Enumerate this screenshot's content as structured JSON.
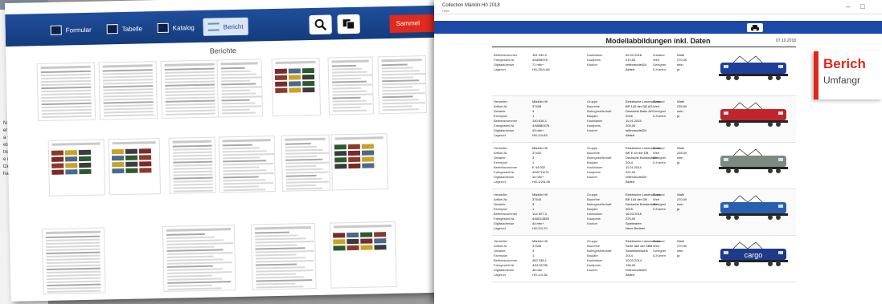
{
  "background_page": {
    "text_lines": [
      "NIC",
      "erb",
      "a G",
      "etric",
      "tren",
      "e n",
      "tzer",
      "halt"
    ]
  },
  "left_app": {
    "tabs": [
      {
        "label": "Formular",
        "icon": "form-icon"
      },
      {
        "label": "Tabelle",
        "icon": "table-icon"
      },
      {
        "label": "Katalog",
        "icon": "catalog-icon"
      },
      {
        "label": "Bericht",
        "icon": "report-icon",
        "active": true
      }
    ],
    "sammel_label": "Sammel",
    "panel_title": "Berichte"
  },
  "right_doc": {
    "window_title": "Collection Märklin H0 2018",
    "window_subtitle": "HBfx",
    "report_title": "Modellabbildungen inkl. Daten",
    "date": "07.10.2018",
    "rows": [
      {
        "col1": [
          [
            "Betriebsnummer",
            "151 032-0"
          ],
          [
            "Fahrgestell-Nr.",
            "4/4835978"
          ],
          [
            "Digitaladresse",
            "71 mfx+"
          ],
          [
            "Lagerort",
            "HG-3D/4-66"
          ]
        ],
        "col2": [
          [
            "Kaufdatum",
            "02.02.2018"
          ],
          [
            "Kaufpreis",
            "210,00"
          ],
          [
            "Kaufort",
            "reflexmodell24"
          ],
          [
            "",
            "Aktiert"
          ]
        ],
        "col3": [
          [
            "Zustand",
            "Wahl"
          ],
          [
            "Wert",
            "270,00"
          ],
          [
            "Geeignet",
            "nein"
          ],
          [
            "D-Karten",
            "ja"
          ]
        ],
        "loco_color": "#1e3f9a"
      },
      {
        "col1": [
          [
            "Hersteller",
            "Märklin H0"
          ],
          [
            "Artikel-Nr.",
            "37438"
          ],
          [
            "Variante",
            "3"
          ],
          [
            "Exemplar",
            "1"
          ],
          [
            "Betriebsnummer",
            "140 816-1"
          ],
          [
            "Fahrgestell-Nr.",
            "4/48680476"
          ],
          [
            "Digitaladresse",
            "43 mfx+"
          ],
          [
            "Lagerort",
            "HG-1/4-83"
          ]
        ],
        "col2": [
          [
            "Gruppe",
            "Elektrische Lokomotiven"
          ],
          [
            "Baureihe",
            "BR 140 der DB AG"
          ],
          [
            "Bahngesellschaft",
            "Deutsche Bahn AG"
          ],
          [
            "Baujahr",
            "2016"
          ],
          [
            "Kaufdatum",
            "11.01.2015"
          ],
          [
            "Kaufpreis",
            "205,00"
          ],
          [
            "Kaufort",
            "reflexmodell24"
          ],
          [
            "",
            "Aktiert"
          ]
        ],
        "col3": [
          [
            "Zustand",
            "Wahl"
          ],
          [
            "Wert",
            "235,00"
          ],
          [
            "Geeignet",
            "nein"
          ],
          [
            "D-Karten",
            "ja"
          ]
        ],
        "loco_color": "#c0252a"
      },
      {
        "col1": [
          [
            "Hersteller",
            "Märklin H0"
          ],
          [
            "Artikel-Nr.",
            "37442"
          ],
          [
            "Variante",
            "3"
          ],
          [
            "Exemplar",
            "1"
          ],
          [
            "Betriebsnummer",
            "E 44 002"
          ],
          [
            "Fahrgestell-Nr.",
            "4/48711174"
          ],
          [
            "Digitaladresse",
            "44 mfx+"
          ],
          [
            "Lagerort",
            "HG-1/2/4-95"
          ]
        ],
        "col2": [
          [
            "Gruppe",
            "Elektrische Lokomotiven"
          ],
          [
            "Baureihe",
            "BR E 44 der DB"
          ],
          [
            "Bahngesellschaft",
            "Deutsche Bundesbahn"
          ],
          [
            "Baujahr",
            "2014"
          ],
          [
            "Kaufdatum",
            "11.01.2014"
          ],
          [
            "Kaufpreis",
            "221,00"
          ],
          [
            "Kaufort",
            "reflexmodell24"
          ],
          [
            "",
            "Aktiert"
          ]
        ],
        "col3": [
          [
            "Zustand",
            "Wahl"
          ],
          [
            "Wert",
            "235,00"
          ],
          [
            "Geeignet",
            "nein"
          ],
          [
            "D-Karten",
            "ja"
          ]
        ],
        "loco_color": "#7d8a80"
      },
      {
        "col1": [
          [
            "Hersteller",
            "Märklin H0"
          ],
          [
            "Artikel-Nr.",
            "37443"
          ],
          [
            "Variante",
            "3"
          ],
          [
            "Exemplar",
            "1"
          ],
          [
            "Betriebsnummer",
            "144 927-3"
          ],
          [
            "Fahrgestell-Nr.",
            "4/48112655"
          ],
          [
            "Digitaladresse",
            "44 mfx+"
          ],
          [
            "Lagerort",
            "HG-2/4-70"
          ]
        ],
        "col2": [
          [
            "Gruppe",
            "Elektrische Lokomotiven"
          ],
          [
            "Baureihe",
            "BR 144 der DB"
          ],
          [
            "Bahngesellschaft",
            "Deutsche Bundesbahn"
          ],
          [
            "Baujahr",
            "2015"
          ],
          [
            "Kaufdatum",
            "16.03.2015"
          ],
          [
            "Kaufpreis",
            "225,00"
          ],
          [
            "Kaufort",
            "Spielwaren"
          ],
          [
            "",
            "Neue Berliner"
          ]
        ],
        "col3": [
          [
            "Zustand",
            "Wahl"
          ],
          [
            "Wert",
            "270,00"
          ],
          [
            "Geeignet",
            "nein"
          ],
          [
            "D-Karten",
            "ja"
          ]
        ],
        "loco_color": "#2a5fb0"
      },
      {
        "col1": [
          [
            "Hersteller",
            "Märklin H0"
          ],
          [
            "Artikel-Nr.",
            "37445"
          ],
          [
            "Variante",
            "3"
          ],
          [
            "Exemplar",
            "1"
          ],
          [
            "Betriebsnummer",
            "482 035-1"
          ],
          [
            "Fahrgestell-Nr.",
            "4/4124796"
          ],
          [
            "Digitaladresse",
            "48 mfx"
          ],
          [
            "Lagerort",
            "HG-1/4-36"
          ]
        ],
        "col2": [
          [
            "Gruppe",
            "Elektrische Lokomotiven"
          ],
          [
            "Baureihe",
            "Serie 482 der SBB"
          ],
          [
            "Bahngesellschaft",
            "Schweizerische"
          ],
          [
            "Baujahr",
            "2014"
          ],
          [
            "Kaufdatum",
            "10.03.2014"
          ],
          [
            "Kaufpreis",
            "196,00"
          ],
          [
            "Kaufort",
            "reflexmodell24"
          ],
          [
            "",
            "Aktiert"
          ]
        ],
        "col3": [
          [
            "Zustand",
            "Wahl"
          ],
          [
            "Wert",
            "270,00"
          ],
          [
            "Geeignet",
            "nein"
          ],
          [
            "D-Karten",
            "ja"
          ]
        ],
        "loco_color": "#1f3a8a",
        "loco_text": "cargo"
      }
    ]
  },
  "callout": {
    "heading": "Berich",
    "subtext": "Umfangr",
    "accent": "#e1261c"
  }
}
